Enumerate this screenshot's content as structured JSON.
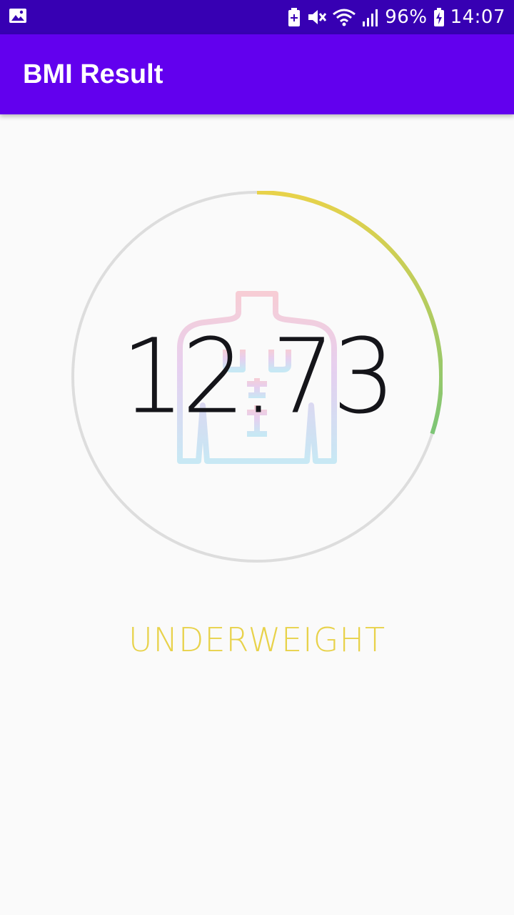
{
  "status_bar": {
    "battery_percent": "96%",
    "time": "14:07",
    "icons": [
      "image-icon",
      "battery-saver-icon",
      "mute-icon",
      "wifi-icon",
      "signal-icon",
      "battery-charging-icon"
    ]
  },
  "app_bar": {
    "title": "BMI Result"
  },
  "result": {
    "bmi_value": "12.73",
    "category": "UNDERWEIGHT",
    "category_color": "#e8d24a",
    "gauge_fraction": 0.3,
    "gauge_gradient": [
      "#e8d24a",
      "#7cc576"
    ],
    "body_icon": "body-silhouette-icon"
  },
  "colors": {
    "status_bar": "#3700b3",
    "app_bar": "#6200ee",
    "background": "#fafafa",
    "track": "#dddddd"
  }
}
